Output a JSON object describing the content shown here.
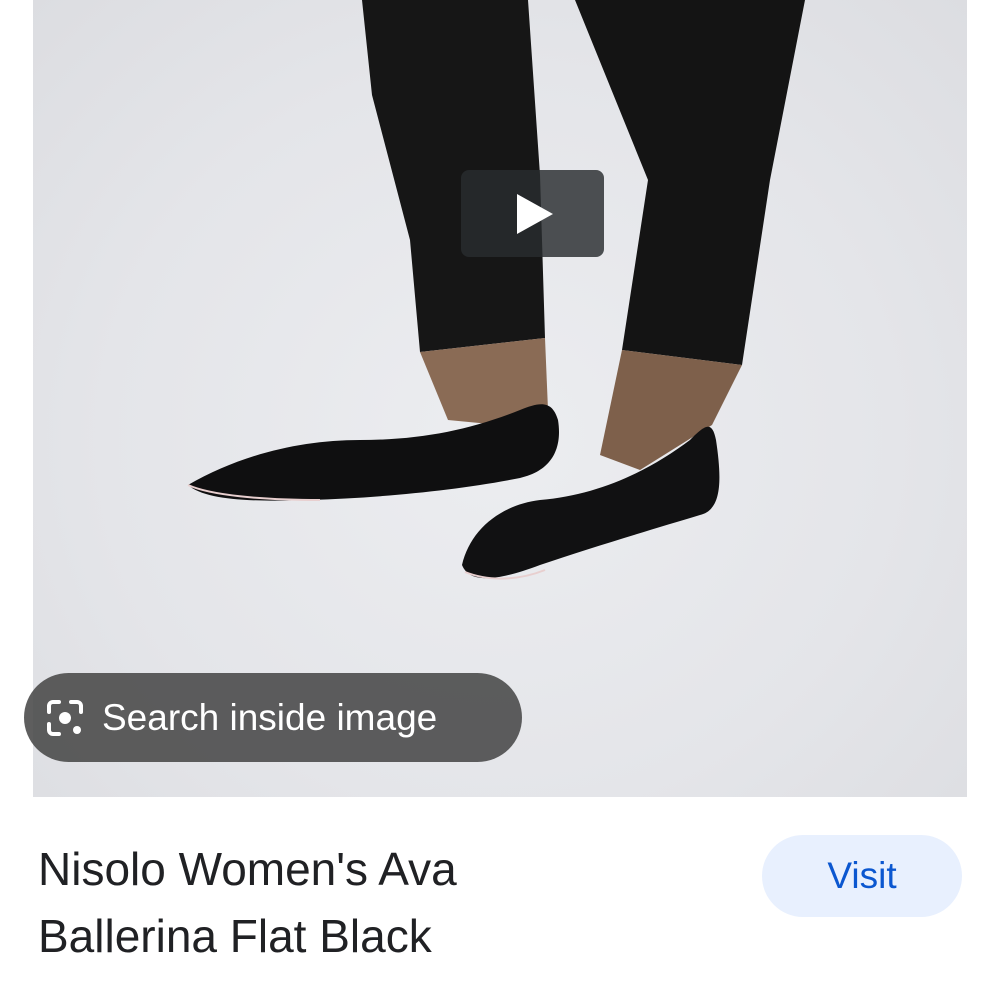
{
  "media": {
    "play_icon": "play-icon",
    "search_inside": {
      "icon": "lens-icon",
      "label": "Search inside image"
    }
  },
  "result": {
    "title_line1": "Nisolo Women's Ava",
    "title_line2": "Ballerina Flat Black",
    "visit_label": "Visit"
  },
  "colors": {
    "visit_bg": "#e8f0fe",
    "visit_text": "#0b57d0",
    "chip_bg": "#484848",
    "title_text": "#202124"
  }
}
